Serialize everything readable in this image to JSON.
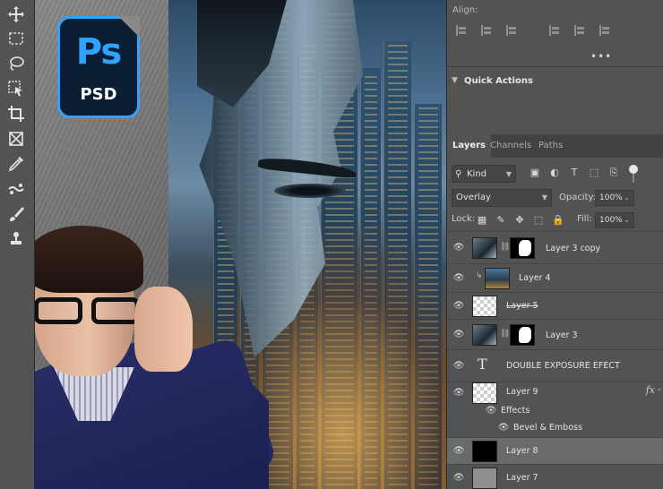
{
  "badge": {
    "main": "Ps",
    "sub": "PSD"
  },
  "tools": [
    {
      "name": "move-tool-icon",
      "glyph": "✥"
    },
    {
      "name": "marquee-tool-icon",
      "glyph": "⬚"
    },
    {
      "name": "lasso-tool-icon",
      "glyph": "◌"
    },
    {
      "name": "object-selection-tool-icon",
      "glyph": "⧉"
    },
    {
      "name": "crop-tool-icon",
      "glyph": "⊥"
    },
    {
      "name": "frame-tool-icon",
      "glyph": "⊠"
    },
    {
      "name": "eyedropper-tool-icon",
      "glyph": "✎"
    },
    {
      "name": "healing-brush-tool-icon",
      "glyph": "✂"
    },
    {
      "name": "brush-tool-icon",
      "glyph": "🖌"
    },
    {
      "name": "stamp-tool-icon",
      "glyph": "⊥"
    }
  ],
  "align": {
    "label": "Align:",
    "more": "•••"
  },
  "quick_actions": {
    "title": "Quick Actions"
  },
  "tabs": [
    {
      "label": "Layers",
      "active": true
    },
    {
      "label": "Channels",
      "active": false
    },
    {
      "label": "Paths",
      "active": false
    }
  ],
  "filter": {
    "kind": "Kind"
  },
  "blend": {
    "mode": "Overlay",
    "opacity_label": "Opacity:",
    "opacity": "100%",
    "fill_label": "Fill:",
    "fill": "100%",
    "lock_label": "Lock:"
  },
  "layers": [
    {
      "name": "Layer 3 copy",
      "thumb": "photo",
      "mask": true
    },
    {
      "name": "Layer 4",
      "thumb": "city",
      "clipped": true
    },
    {
      "name": "Layer 5",
      "thumb": "checker",
      "strike": true
    },
    {
      "name": "Layer 3",
      "thumb": "photo",
      "mask": true
    },
    {
      "name": "DOUBLE EXPOSURE EFECT",
      "thumb": "text"
    },
    {
      "name": "Layer 9",
      "thumb": "checker",
      "fx": true
    },
    {
      "name": "Effects",
      "sub": true
    },
    {
      "name": "Bevel & Emboss",
      "sub2": true
    },
    {
      "name": "Layer 8",
      "thumb": "black",
      "selected": true
    },
    {
      "name": "Layer 7",
      "thumb": "gray"
    }
  ],
  "colors": {
    "panel": "#535353",
    "accent": "#2fa3ff",
    "badge_bg": "#0b1e33"
  }
}
